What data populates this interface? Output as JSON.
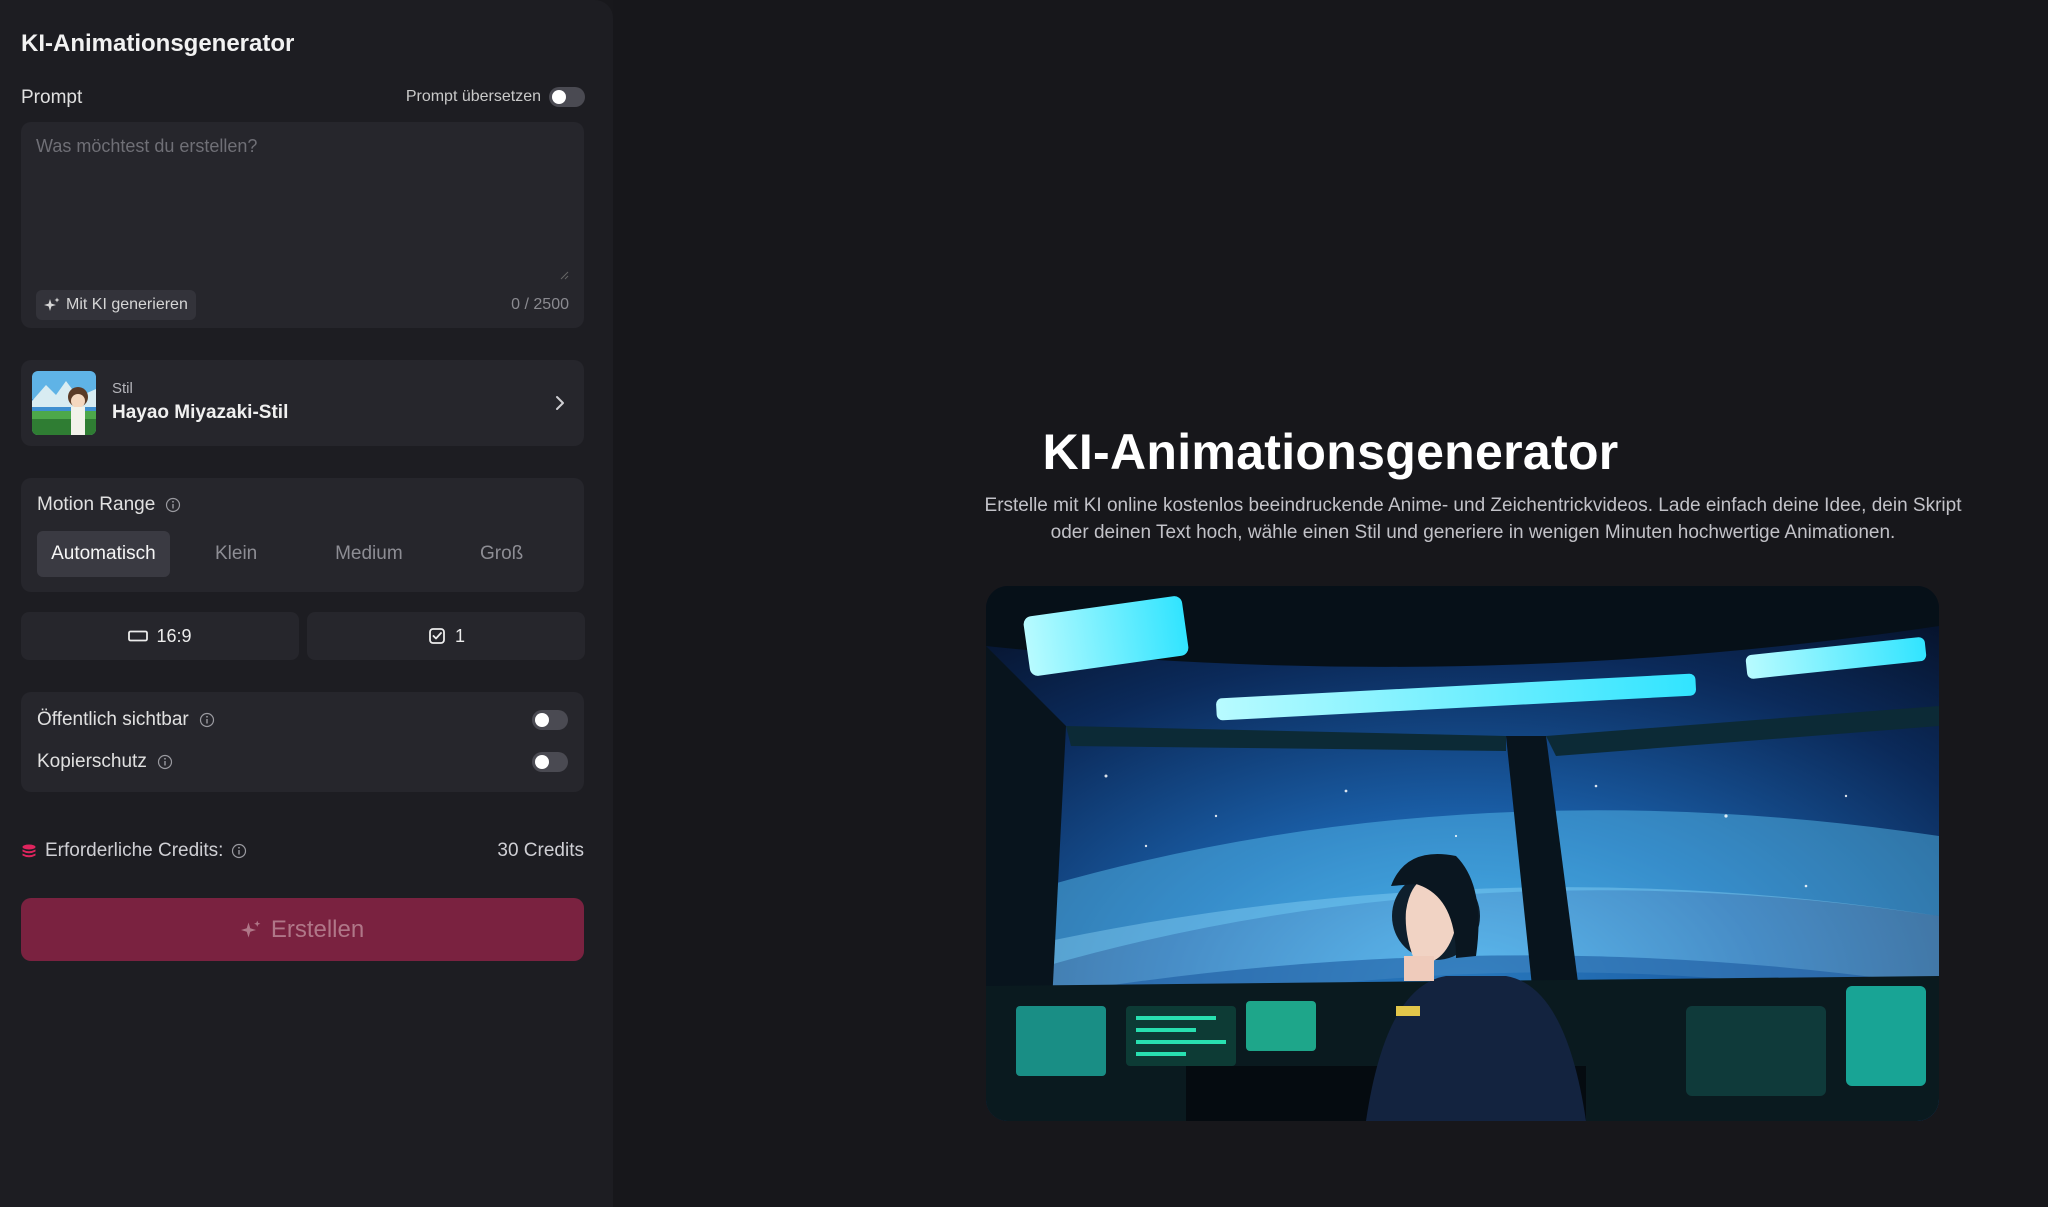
{
  "sidebar": {
    "title": "KI-Animationsgenerator",
    "prompt": {
      "label": "Prompt",
      "translate_label": "Prompt übersetzen",
      "translate_enabled": false,
      "placeholder": "Was möchtest du erstellen?",
      "value": "",
      "generate_ai_label": "Mit KI generieren",
      "char_count": "0 / 2500"
    },
    "style": {
      "label": "Stil",
      "value": "Hayao Miyazaki-Stil"
    },
    "motion": {
      "label": "Motion Range",
      "options": [
        "Automatisch",
        "Klein",
        "Medium",
        "Groß"
      ],
      "selected": "Automatisch"
    },
    "aspect_ratio": "16:9",
    "count": "1",
    "privacy": {
      "public_label": "Öffentlich sichtbar",
      "public_enabled": false,
      "copy_protection_label": "Kopierschutz",
      "copy_protection_enabled": false
    },
    "credits": {
      "label": "Erforderliche Credits:",
      "value": "30 Credits"
    },
    "create_label": "Erstellen"
  },
  "main": {
    "title": "KI-Animationsgenerator",
    "subtitle": "Erstelle mit KI online kostenlos beeindruckende Anime- und Zeichentrickvideos. Lade einfach deine Idee, dein Skript oder deinen Text hoch, wähle einen Stil und generiere in wenigen Minuten hochwertige Animationen."
  },
  "colors": {
    "accent": "#7a2240",
    "credits_icon": "#e0245e",
    "panel": "#26262c",
    "sidebar_bg": "#1d1d22",
    "main_bg": "#17171b"
  },
  "icons": [
    "sparkle-icon",
    "resize-grip-icon",
    "chevron-right-icon",
    "info-icon",
    "aspect-ratio-icon",
    "image-count-icon",
    "credits-stack-icon"
  ]
}
